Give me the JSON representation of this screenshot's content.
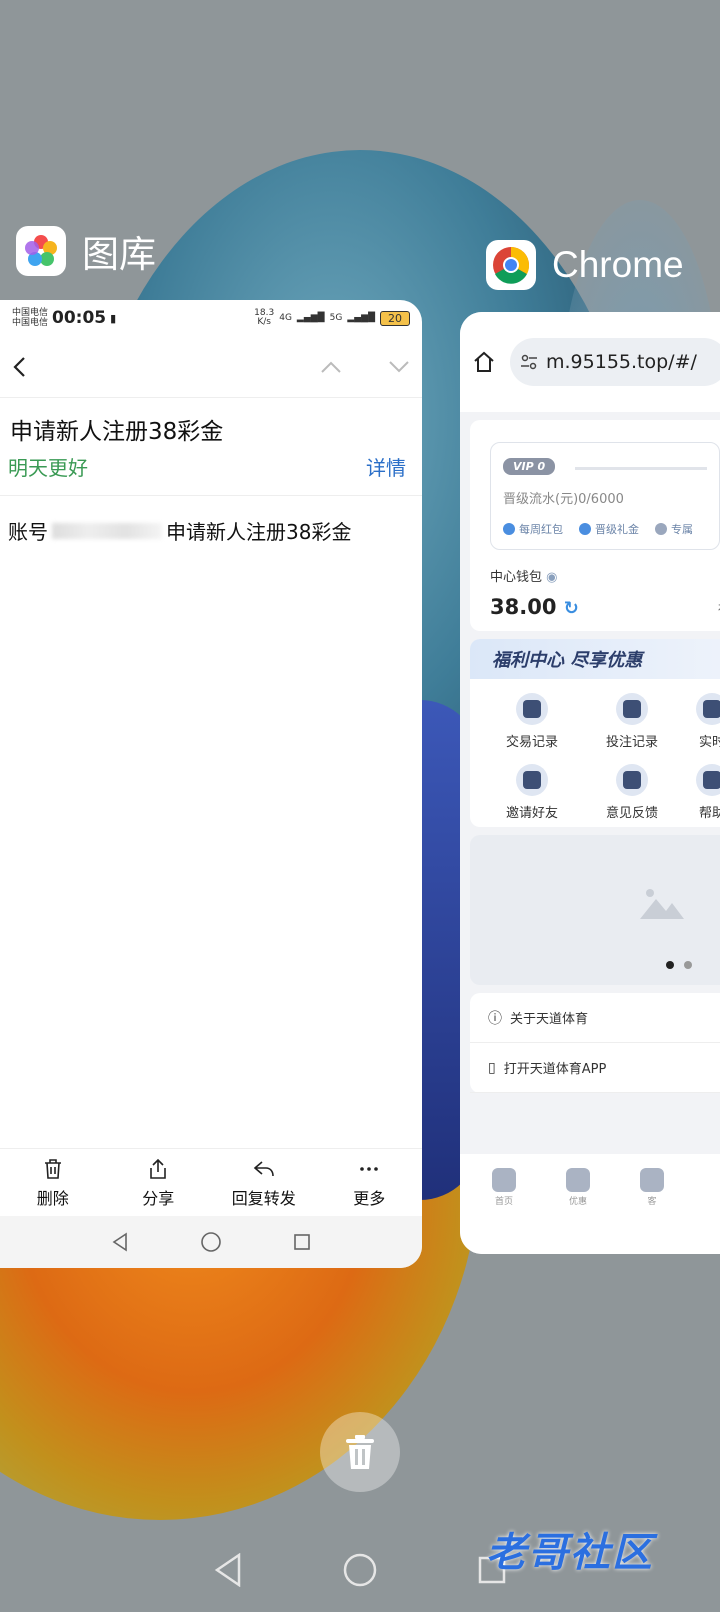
{
  "recents": {
    "gallery_app_name": "图库",
    "chrome_app_name": "Chrome"
  },
  "gallery": {
    "status": {
      "carrier1": "中国电信",
      "carrier2": "中国电信",
      "time": "00:05",
      "speed_top": "18.3",
      "speed_unit": "K/s",
      "net1": "4G",
      "net2": "5G",
      "battery": "20"
    },
    "message_title": "申请新人注册38彩金",
    "sender": "明天更好",
    "detail_link": "详情",
    "body_prefix": "账号",
    "body_suffix": "申请新人注册38彩金",
    "toolbar": {
      "delete": "删除",
      "share": "分享",
      "reply_forward": "回复转发",
      "more": "更多"
    }
  },
  "chrome": {
    "url": "m.95155.top/#/",
    "vip_badge": "VIP 0",
    "vip_flow": "晋级流水(元)0/6000",
    "tags": [
      "每周红包",
      "晋级礼金",
      "专属"
    ],
    "wallet_label": "中心钱包",
    "wallet_value": "38.00",
    "deposit_label": "存",
    "welfare_title": "福利中心 尽享优惠",
    "grid": [
      "交易记录",
      "投注记录",
      "实时",
      "邀请好友",
      "意见反馈",
      "帮助"
    ],
    "links": [
      "关于天道体育",
      "打开天道体育APP"
    ],
    "tabs": [
      "首页",
      "优惠",
      "客"
    ]
  },
  "watermark": "老哥社区"
}
